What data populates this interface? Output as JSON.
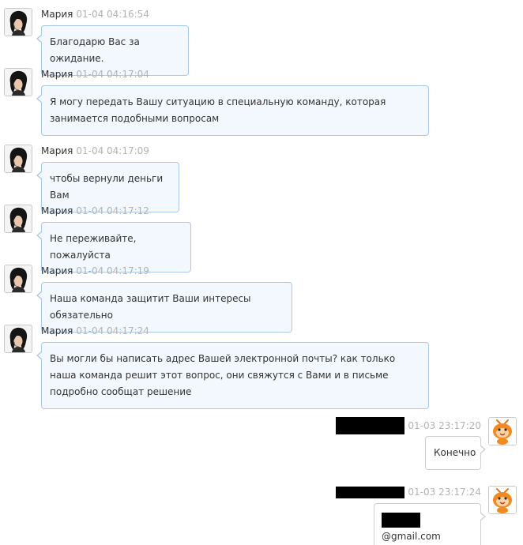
{
  "agent": {
    "name": "Мария"
  },
  "messages": [
    {
      "time": "01-04 04:16:54",
      "text": "Благодарю Вас за ожидание."
    },
    {
      "time": "01-04 04:17:04",
      "text": "Я могу передать Вашу ситуацию в специальную команду, которая занимается подобными вопросам"
    },
    {
      "time": "01-04 04:17:09",
      "text": "чтобы вернули деньги Вам"
    },
    {
      "time": "01-04 04:17:12",
      "text": "Не переживайте, пожалуйста"
    },
    {
      "time": "01-04 04:17:19",
      "text": "Наша команда защитит Ваши интересы обязательно"
    },
    {
      "time": "01-04 04:17:24",
      "text": "Вы могли бы написать адрес Вашей электронной почты? как только наша команда решит этот вопрос, они свяжутся с Вами и в письме подробно сообщат решение"
    },
    {
      "time": "01-03 23:17:20",
      "text": "Конечно"
    },
    {
      "time": "01-03 23:17:24",
      "text": "@gmail.com"
    }
  ]
}
